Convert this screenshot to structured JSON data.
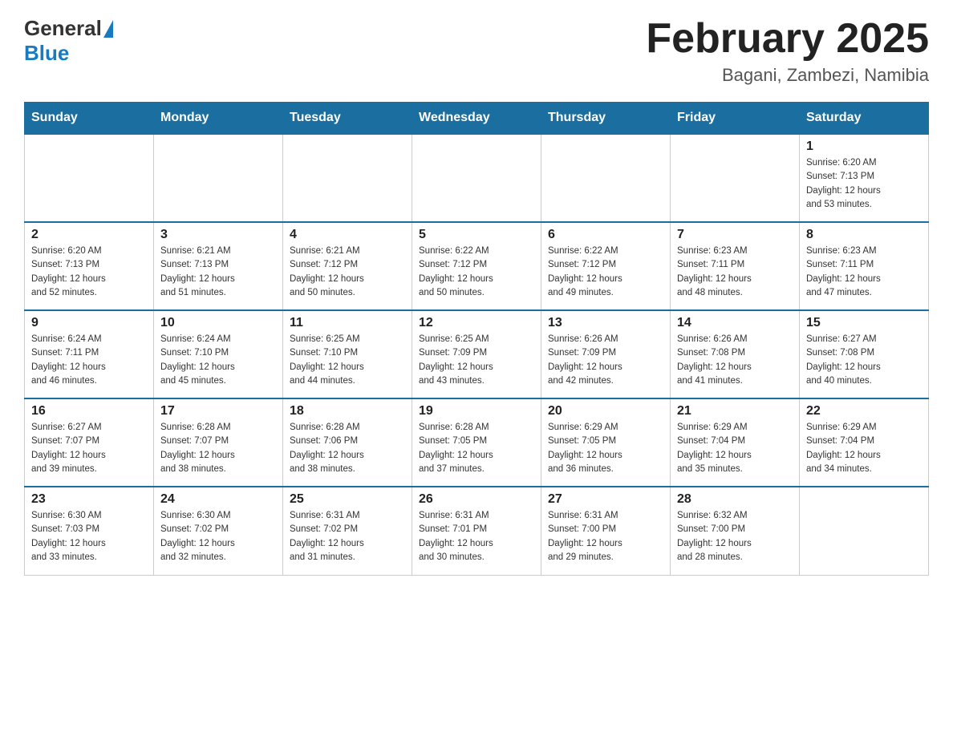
{
  "header": {
    "logo": {
      "part1": "General",
      "part2": "Blue"
    },
    "title": "February 2025",
    "location": "Bagani, Zambezi, Namibia"
  },
  "weekdays": [
    "Sunday",
    "Monday",
    "Tuesday",
    "Wednesday",
    "Thursday",
    "Friday",
    "Saturday"
  ],
  "weeks": [
    [
      {
        "day": "",
        "info": ""
      },
      {
        "day": "",
        "info": ""
      },
      {
        "day": "",
        "info": ""
      },
      {
        "day": "",
        "info": ""
      },
      {
        "day": "",
        "info": ""
      },
      {
        "day": "",
        "info": ""
      },
      {
        "day": "1",
        "info": "Sunrise: 6:20 AM\nSunset: 7:13 PM\nDaylight: 12 hours\nand 53 minutes."
      }
    ],
    [
      {
        "day": "2",
        "info": "Sunrise: 6:20 AM\nSunset: 7:13 PM\nDaylight: 12 hours\nand 52 minutes."
      },
      {
        "day": "3",
        "info": "Sunrise: 6:21 AM\nSunset: 7:13 PM\nDaylight: 12 hours\nand 51 minutes."
      },
      {
        "day": "4",
        "info": "Sunrise: 6:21 AM\nSunset: 7:12 PM\nDaylight: 12 hours\nand 50 minutes."
      },
      {
        "day": "5",
        "info": "Sunrise: 6:22 AM\nSunset: 7:12 PM\nDaylight: 12 hours\nand 50 minutes."
      },
      {
        "day": "6",
        "info": "Sunrise: 6:22 AM\nSunset: 7:12 PM\nDaylight: 12 hours\nand 49 minutes."
      },
      {
        "day": "7",
        "info": "Sunrise: 6:23 AM\nSunset: 7:11 PM\nDaylight: 12 hours\nand 48 minutes."
      },
      {
        "day": "8",
        "info": "Sunrise: 6:23 AM\nSunset: 7:11 PM\nDaylight: 12 hours\nand 47 minutes."
      }
    ],
    [
      {
        "day": "9",
        "info": "Sunrise: 6:24 AM\nSunset: 7:11 PM\nDaylight: 12 hours\nand 46 minutes."
      },
      {
        "day": "10",
        "info": "Sunrise: 6:24 AM\nSunset: 7:10 PM\nDaylight: 12 hours\nand 45 minutes."
      },
      {
        "day": "11",
        "info": "Sunrise: 6:25 AM\nSunset: 7:10 PM\nDaylight: 12 hours\nand 44 minutes."
      },
      {
        "day": "12",
        "info": "Sunrise: 6:25 AM\nSunset: 7:09 PM\nDaylight: 12 hours\nand 43 minutes."
      },
      {
        "day": "13",
        "info": "Sunrise: 6:26 AM\nSunset: 7:09 PM\nDaylight: 12 hours\nand 42 minutes."
      },
      {
        "day": "14",
        "info": "Sunrise: 6:26 AM\nSunset: 7:08 PM\nDaylight: 12 hours\nand 41 minutes."
      },
      {
        "day": "15",
        "info": "Sunrise: 6:27 AM\nSunset: 7:08 PM\nDaylight: 12 hours\nand 40 minutes."
      }
    ],
    [
      {
        "day": "16",
        "info": "Sunrise: 6:27 AM\nSunset: 7:07 PM\nDaylight: 12 hours\nand 39 minutes."
      },
      {
        "day": "17",
        "info": "Sunrise: 6:28 AM\nSunset: 7:07 PM\nDaylight: 12 hours\nand 38 minutes."
      },
      {
        "day": "18",
        "info": "Sunrise: 6:28 AM\nSunset: 7:06 PM\nDaylight: 12 hours\nand 38 minutes."
      },
      {
        "day": "19",
        "info": "Sunrise: 6:28 AM\nSunset: 7:05 PM\nDaylight: 12 hours\nand 37 minutes."
      },
      {
        "day": "20",
        "info": "Sunrise: 6:29 AM\nSunset: 7:05 PM\nDaylight: 12 hours\nand 36 minutes."
      },
      {
        "day": "21",
        "info": "Sunrise: 6:29 AM\nSunset: 7:04 PM\nDaylight: 12 hours\nand 35 minutes."
      },
      {
        "day": "22",
        "info": "Sunrise: 6:29 AM\nSunset: 7:04 PM\nDaylight: 12 hours\nand 34 minutes."
      }
    ],
    [
      {
        "day": "23",
        "info": "Sunrise: 6:30 AM\nSunset: 7:03 PM\nDaylight: 12 hours\nand 33 minutes."
      },
      {
        "day": "24",
        "info": "Sunrise: 6:30 AM\nSunset: 7:02 PM\nDaylight: 12 hours\nand 32 minutes."
      },
      {
        "day": "25",
        "info": "Sunrise: 6:31 AM\nSunset: 7:02 PM\nDaylight: 12 hours\nand 31 minutes."
      },
      {
        "day": "26",
        "info": "Sunrise: 6:31 AM\nSunset: 7:01 PM\nDaylight: 12 hours\nand 30 minutes."
      },
      {
        "day": "27",
        "info": "Sunrise: 6:31 AM\nSunset: 7:00 PM\nDaylight: 12 hours\nand 29 minutes."
      },
      {
        "day": "28",
        "info": "Sunrise: 6:32 AM\nSunset: 7:00 PM\nDaylight: 12 hours\nand 28 minutes."
      },
      {
        "day": "",
        "info": ""
      }
    ]
  ]
}
